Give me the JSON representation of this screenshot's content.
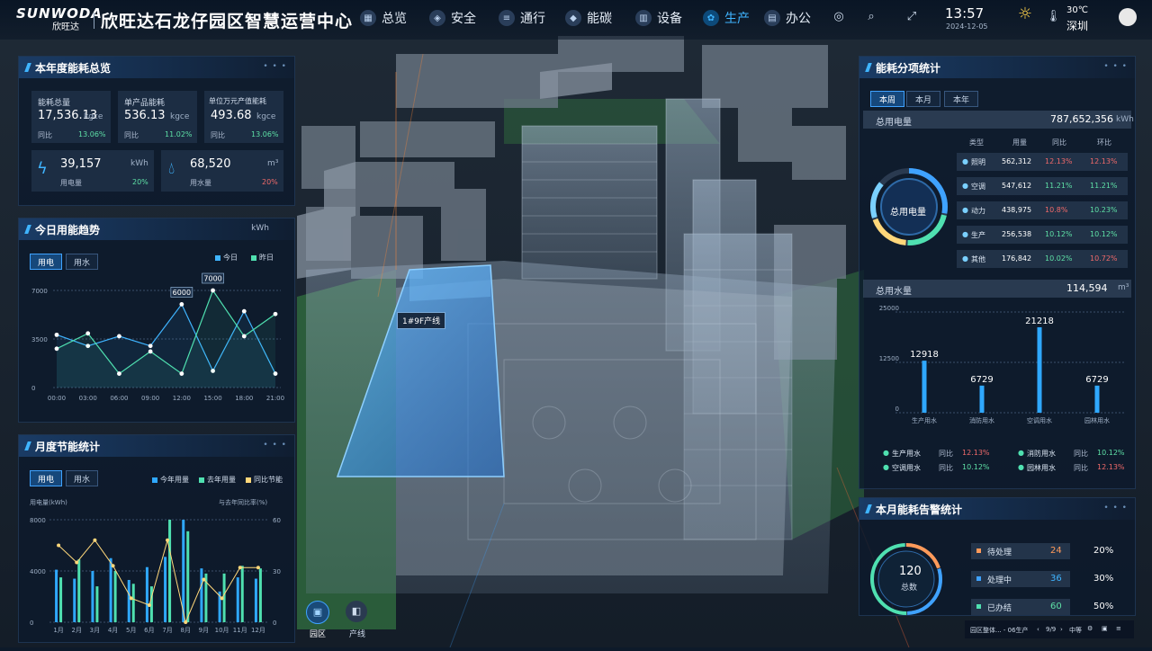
{
  "header": {
    "brand": "SUNWODA",
    "brand_sub": "欣旺达",
    "title": "欣旺达石龙仔园区智慧运营中心",
    "nav": [
      {
        "label": "总览",
        "icon": "grid-icon"
      },
      {
        "label": "安全",
        "icon": "shield-icon"
      },
      {
        "label": "通行",
        "icon": "gate-icon"
      },
      {
        "label": "能碳",
        "icon": "leaf-icon"
      },
      {
        "label": "设备",
        "icon": "device-icon"
      },
      {
        "label": "生产",
        "icon": "gear-icon",
        "active": true
      },
      {
        "label": "办公",
        "icon": "office-icon"
      }
    ],
    "time": "13:57",
    "date": "2024-12-05",
    "temperature": "30℃",
    "city": "深圳"
  },
  "energy_overview": {
    "title": "本年度能耗总览",
    "cards": [
      {
        "label": "能耗总量",
        "value": "17,536.13",
        "unit": "kgce",
        "compare_label": "同比",
        "compare": "13.06%"
      },
      {
        "label": "单产品能耗",
        "value": "536.13",
        "unit": "kgce",
        "compare_label": "同比",
        "compare": "11.02%"
      },
      {
        "label": "单位万元产值能耗",
        "value": "493.68",
        "unit": "kgce",
        "compare_label": "同比",
        "compare": "13.06%"
      }
    ],
    "electricity": {
      "value": "39,157",
      "unit": "kWh",
      "label": "用电量",
      "change": "20%"
    },
    "water": {
      "value": "68,520",
      "unit": "m³",
      "label": "用水量",
      "change": "20%"
    }
  },
  "daily_trend": {
    "title": "今日用能趋势",
    "unit": "kWh",
    "tabs": [
      "用电",
      "用水"
    ],
    "legend": [
      "今日",
      "昨日"
    ],
    "callouts": [
      "6000",
      "7000"
    ]
  },
  "monthly_saving": {
    "title": "月度节能统计",
    "tabs": [
      "用电",
      "用水"
    ],
    "legend": [
      "今年用量",
      "去年用量",
      "同比节能"
    ],
    "left_axis_label": "用电量(kWh)",
    "right_axis_label": "与去年同比率(%)"
  },
  "building_label": "1#9F产线",
  "bottom_nav": [
    {
      "label": "园区",
      "icon": "park-icon"
    },
    {
      "label": "产线",
      "icon": "line-icon"
    }
  ],
  "energy_breakdown": {
    "title": "能耗分项统计",
    "tabs": [
      "本周",
      "本月",
      "本年"
    ],
    "total_electricity_label": "总用电量",
    "total_electricity": "787,652,356",
    "total_electricity_unit": "kWh",
    "ring_label": "总用电量",
    "table_headers": [
      "类型",
      "用量",
      "同比",
      "环比"
    ],
    "rows": [
      {
        "name": "照明",
        "usage": "562,312",
        "yoy": "12.13%",
        "mom": "12.13%"
      },
      {
        "name": "空调",
        "usage": "547,612",
        "yoy": "11.21%",
        "mom": "11.21%"
      },
      {
        "name": "动力",
        "usage": "438,975",
        "yoy": "10.8%",
        "mom": "10.23%"
      },
      {
        "name": "生产",
        "usage": "256,538",
        "yoy": "10.12%",
        "mom": "10.12%"
      },
      {
        "name": "其他",
        "usage": "176,842",
        "yoy": "10.02%",
        "mom": "10.72%"
      }
    ],
    "total_water_label": "总用水量",
    "total_water": "114,594",
    "total_water_unit": "m³",
    "water_bottom": [
      {
        "name": "生产用水",
        "label": "同比",
        "value": "12.13%"
      },
      {
        "name": "消防用水",
        "label": "同比",
        "value": "10.12%"
      },
      {
        "name": "空调用水",
        "label": "同比",
        "value": "10.12%"
      },
      {
        "name": "园林用水",
        "label": "同比",
        "value": "12.13%"
      }
    ]
  },
  "alarm_stats": {
    "title": "本月能耗告警统计",
    "total": "120",
    "total_label": "总数",
    "items": [
      {
        "label": "待处理",
        "count": "24",
        "pct": "20%"
      },
      {
        "label": "处理中",
        "count": "36",
        "pct": "30%"
      },
      {
        "label": "已办结",
        "count": "60",
        "pct": "50%"
      }
    ]
  },
  "bottom_bar": {
    "breadcrumb": "园区整体... - 06生产",
    "page": "9/9",
    "mode": "中等"
  },
  "chart_data": [
    {
      "type": "line",
      "categories": [
        "00:00",
        "03:00",
        "06:00",
        "09:00",
        "12:00",
        "15:00",
        "18:00",
        "21:00"
      ],
      "series": [
        {
          "name": "今日",
          "values": [
            3800,
            3000,
            3700,
            3000,
            6000,
            1200,
            5500,
            1000
          ],
          "color": "#3fb4ff"
        },
        {
          "name": "昨日",
          "values": [
            2800,
            3900,
            1000,
            2600,
            1000,
            7000,
            3700,
            5300
          ],
          "color": "#4fe0b0"
        }
      ],
      "xlabel": "",
      "ylabel": "",
      "y_ticks": [
        "0",
        "3500",
        "7000"
      ],
      "ylim": [
        0,
        7000
      ],
      "grid": true
    },
    {
      "type": "bar",
      "categories": [
        "1月",
        "2月",
        "3月",
        "4月",
        "5月",
        "6月",
        "7月",
        "8月",
        "9月",
        "10月",
        "11月",
        "12月"
      ],
      "series": [
        {
          "name": "今年用量",
          "values": [
            4100,
            3400,
            4000,
            5000,
            3300,
            4300,
            5100,
            8000,
            4200,
            2400,
            3500,
            3400
          ],
          "color": "#2fa8ff"
        },
        {
          "name": "去年用量",
          "values": [
            3500,
            4900,
            2800,
            4000,
            3000,
            2800,
            8000,
            7100,
            3800,
            3800,
            4400,
            4200
          ],
          "color": "#4fe0b0"
        }
      ],
      "line_series": {
        "name": "同比节能",
        "values": [
          45,
          35,
          48,
          33,
          14,
          10,
          48,
          0,
          25,
          14,
          32,
          32
        ],
        "color": "#ffd77a"
      },
      "y_ticks": [
        "0",
        "4000",
        "8000"
      ],
      "y_right_ticks": [
        "0",
        "30",
        "60"
      ],
      "ylim": [
        0,
        8000
      ],
      "y_right_lim": [
        0,
        60
      ],
      "grid": true
    },
    {
      "type": "bar",
      "categories": [
        "生产用水",
        "消防用水",
        "空调用水",
        "园林用水"
      ],
      "values": [
        12918,
        6729,
        21218,
        6729
      ],
      "y_ticks": [
        "0",
        "12500",
        "25000"
      ],
      "ylim": [
        0,
        25000
      ],
      "grid": true
    }
  ]
}
